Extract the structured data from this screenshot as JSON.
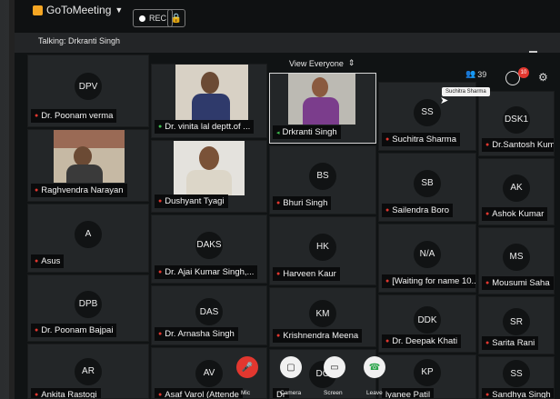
{
  "app": {
    "name": "GoToMeeting"
  },
  "toolbar": {
    "rec_label": "REC"
  },
  "subbar": {
    "talking": "Talking: Drkranti Singh",
    "view": "View Everyone"
  },
  "header": {
    "participant_count": "39",
    "chat_badge": "10",
    "tooltip": "Suchitra Sharma"
  },
  "tiles": [
    {
      "initials": "DPV",
      "name": "Dr. Poonam verma"
    },
    {
      "initials": "",
      "name": "Dr. vinita lal deptt.of ..."
    },
    {
      "initials": "",
      "name": "Drkranti Singh"
    },
    {
      "initials": "SS",
      "name": "Suchitra Sharma"
    },
    {
      "initials": "DSK1",
      "name": "Dr.Santosh Kumar"
    },
    {
      "initials": "",
      "name": "Raghvendra Narayan"
    },
    {
      "initials": "",
      "name": "Dushyant Tyagi"
    },
    {
      "initials": "BS",
      "name": "Bhuri Singh"
    },
    {
      "initials": "SB",
      "name": "Sailendra Boro"
    },
    {
      "initials": "AK",
      "name": "Ashok Kumar"
    },
    {
      "initials": "A",
      "name": "Asus"
    },
    {
      "initials": "DAKS",
      "name": "Dr. Ajai Kumar Singh,..."
    },
    {
      "initials": "HK",
      "name": "Harveen Kaur"
    },
    {
      "initials": "N/A",
      "name": "[Waiting for name 10..."
    },
    {
      "initials": "MS",
      "name": "Mousumi Saha"
    },
    {
      "initials": "DPB",
      "name": "Dr. Poonam Bajpai"
    },
    {
      "initials": "DAS",
      "name": "Dr. Arnasha Singh"
    },
    {
      "initials": "KM",
      "name": "Krishnendra Meena"
    },
    {
      "initials": "DDK",
      "name": "Dr. Deepak Khati"
    },
    {
      "initials": "SR",
      "name": "Sarita Rani"
    },
    {
      "initials": "AR",
      "name": "Ankita Rastogi"
    },
    {
      "initials": "AV",
      "name": "Asaf Varol (Attende"
    },
    {
      "initials": "DG",
      "name": "Dr"
    },
    {
      "initials": "KP",
      "name": "lyanee Patil"
    },
    {
      "initials": "SS",
      "name": "Sandhya Singh"
    }
  ],
  "controls": {
    "mic": "Mic",
    "camera": "Camera",
    "screen": "Screen",
    "leave": "Leave"
  },
  "colors": {
    "mic_muted": "#e2372f",
    "tile_bg": "#232628",
    "background": "#101314"
  }
}
